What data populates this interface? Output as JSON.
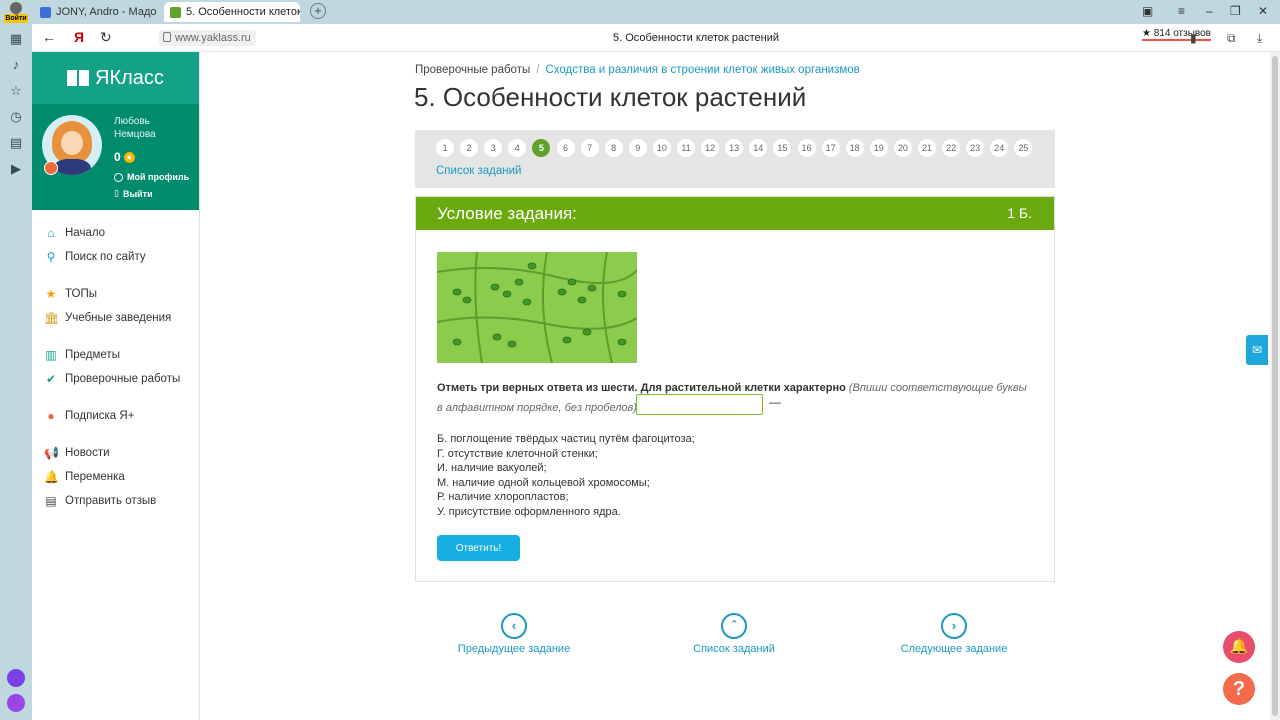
{
  "browser": {
    "login_label": "Войти",
    "tabs": [
      {
        "label": "JONY, Andro - Мадо",
        "active": false
      },
      {
        "label": "5. Особенности клеток",
        "active": true
      }
    ],
    "url": "www.yaklass.ru",
    "page_title": "5. Особенности клеток растений",
    "reviews": "814 отзывов"
  },
  "site": {
    "logo": "ЯКласс",
    "user": {
      "name": "Любовь Немцова",
      "points": "0"
    },
    "profile_links": {
      "profile": "Мой профиль",
      "logout": "Выйти"
    },
    "menu": [
      {
        "label": "Начало",
        "icon": "home-icon"
      },
      {
        "label": "Поиск по сайту",
        "icon": "search-icon"
      },
      {
        "label": "ТОПы",
        "icon": "star-icon"
      },
      {
        "label": "Учебные заведения",
        "icon": "institution-icon"
      },
      {
        "label": "Предметы",
        "icon": "book-icon"
      },
      {
        "label": "Проверочные работы",
        "icon": "check-circle-icon"
      },
      {
        "label": "Подписка Я+",
        "icon": "subscription-icon"
      },
      {
        "label": "Новости",
        "icon": "megaphone-icon"
      },
      {
        "label": "Переменка",
        "icon": "bell-icon"
      },
      {
        "label": "Отправить отзыв",
        "icon": "feedback-icon"
      }
    ]
  },
  "breadcrumb": {
    "root": "Проверочные работы",
    "current": "Сходства и различия в строении клеток живых организмов"
  },
  "title": "5. Особенности клеток растений",
  "pager": {
    "pages": [
      "1",
      "2",
      "3",
      "4",
      "5",
      "6",
      "7",
      "8",
      "9",
      "10",
      "11",
      "12",
      "13",
      "14",
      "15",
      "16",
      "17",
      "18",
      "19",
      "20",
      "21",
      "22",
      "23",
      "24",
      "25"
    ],
    "current": "5",
    "list_link": "Список заданий"
  },
  "task": {
    "header": "Условие задания:",
    "points": "1 Б.",
    "question_bold": "Отметь три верных ответа из шести. Для растительной клетки характерно",
    "question_hint": "(Впиши соответствующие буквы в алфавитном порядке, без пробелов)",
    "answer_value": "",
    "dash": "—",
    "options": [
      "Б. поглощение твёрдых частиц путём фагоцитоза;",
      "Г. отсутствие клеточной стенки;",
      "И. наличие вакуолей;",
      "М.  наличие одной кольцевой хромосомы;",
      "Р. наличие хлоропластов;",
      "У. присутствие оформленного ядра."
    ],
    "submit": "Ответить!"
  },
  "nav": {
    "prev": "Предыдущее задание",
    "list": "Список заданий",
    "next": "Следующее задание"
  },
  "colors": {
    "brand_green": "#14a286",
    "profile_green": "#008b6d",
    "task_header": "#6aaa0e",
    "current_page": "#5fa32c",
    "link": "#1a98c6",
    "submit": "#17aee3"
  }
}
